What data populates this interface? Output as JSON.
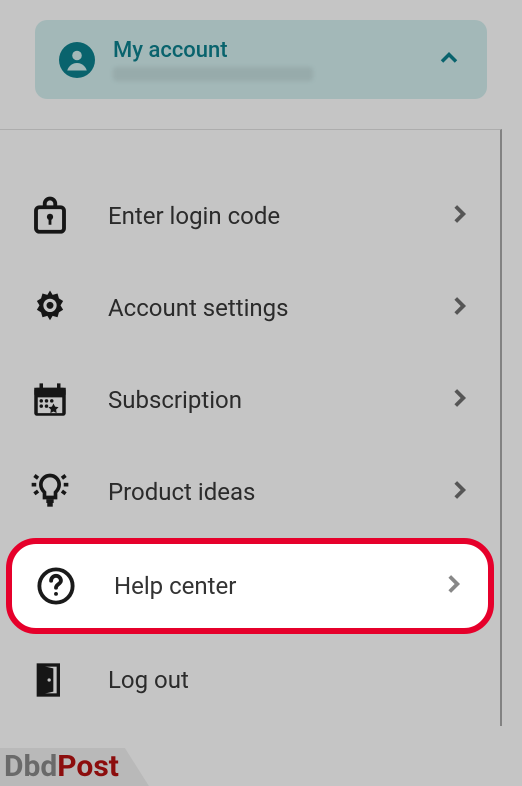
{
  "header": {
    "account_label": "My account"
  },
  "menu": {
    "items": [
      {
        "label": "Enter login code"
      },
      {
        "label": "Account settings"
      },
      {
        "label": "Subscription"
      },
      {
        "label": "Product ideas"
      },
      {
        "label": "Help center"
      },
      {
        "label": "Log out"
      }
    ]
  },
  "watermark": {
    "part1": "Dbd",
    "part2": "Post"
  }
}
